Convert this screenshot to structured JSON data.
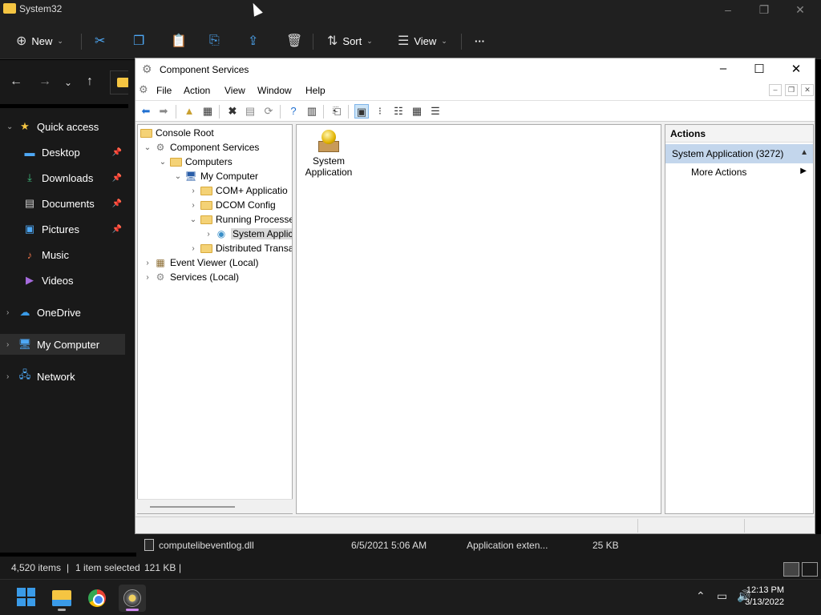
{
  "explorer": {
    "title": "System32",
    "toolbar": {
      "new_label": "New",
      "sort_label": "Sort",
      "view_label": "View",
      "more_label": "···"
    },
    "sidebar": {
      "items": [
        {
          "label": "Quick access",
          "icon": "star-icon"
        },
        {
          "label": "Desktop",
          "icon": "desktop-icon"
        },
        {
          "label": "Downloads",
          "icon": "download-icon"
        },
        {
          "label": "Documents",
          "icon": "document-icon"
        },
        {
          "label": "Pictures",
          "icon": "pictures-icon"
        },
        {
          "label": "Music",
          "icon": "music-icon"
        },
        {
          "label": "Videos",
          "icon": "videos-icon"
        },
        {
          "label": "OneDrive",
          "icon": "cloud-icon"
        },
        {
          "label": "My Computer",
          "icon": "computer-icon"
        },
        {
          "label": "Network",
          "icon": "network-icon"
        }
      ]
    },
    "file_row": {
      "name": "computelibeventlog.dll",
      "date": "6/5/2021 5:06 AM",
      "type": "Application exten...",
      "size": "25 KB"
    },
    "status": {
      "items": "4,520 items",
      "selected": "1 item selected",
      "selected_size": "121 KB"
    }
  },
  "component_services": {
    "title": "Component Services",
    "menu": [
      "File",
      "Action",
      "View",
      "Window",
      "Help"
    ],
    "tree": [
      {
        "label": "Console Root"
      },
      {
        "label": "Component Services"
      },
      {
        "label": "Computers"
      },
      {
        "label": "My Computer"
      },
      {
        "label": "COM+ Applicatio"
      },
      {
        "label": "DCOM Config"
      },
      {
        "label": "Running Processe"
      },
      {
        "label": "System Applic"
      },
      {
        "label": "Distributed Transa"
      },
      {
        "label": "Event Viewer (Local)"
      },
      {
        "label": "Services (Local)"
      }
    ],
    "main_item": {
      "line1": "System",
      "line2": "Application"
    },
    "actions": {
      "header": "Actions",
      "section": "System Application (3272)",
      "more": "More Actions"
    }
  },
  "taskbar": {
    "time": "12:13 PM",
    "date": "3/13/2022"
  },
  "colors": {
    "explorer_bg": "#191919",
    "accent_blue": "#4ea8f5",
    "actions_highlight": "#c3d6ec",
    "folder_yellow": "#f5c542"
  }
}
